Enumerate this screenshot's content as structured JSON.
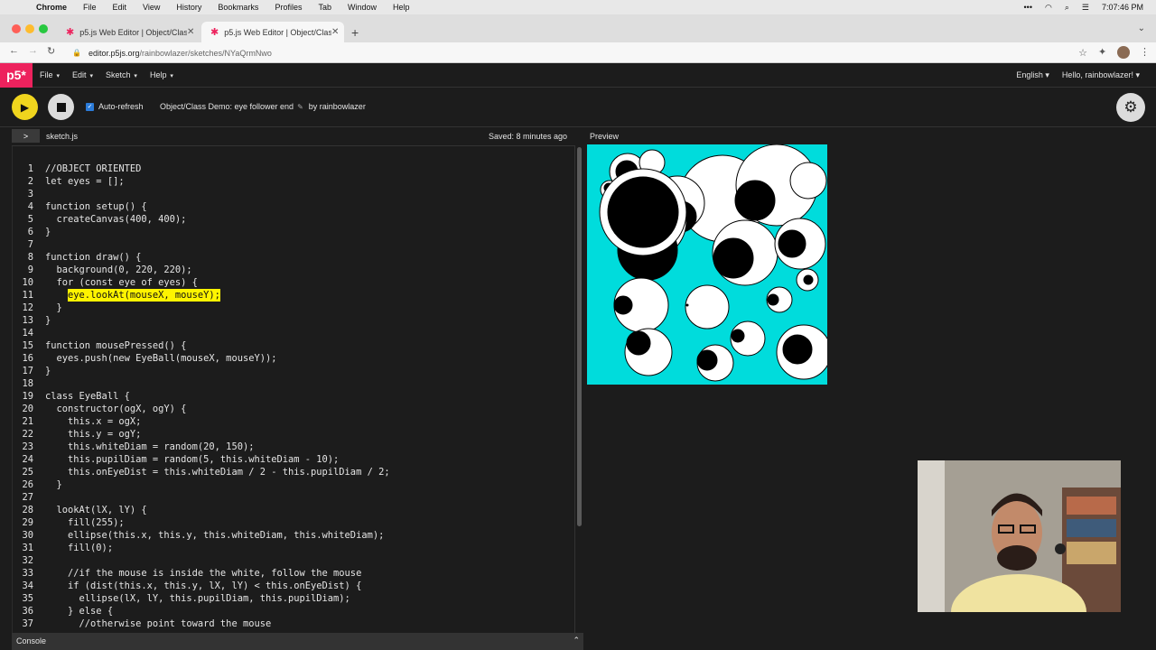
{
  "menubar": {
    "app": "Chrome",
    "items": [
      "File",
      "Edit",
      "View",
      "History",
      "Bookmarks",
      "Profiles",
      "Tab",
      "Window",
      "Help"
    ],
    "clock": "7:07:46 PM"
  },
  "browser": {
    "tabs": [
      {
        "title": "p5.js Web Editor | Object/Class"
      },
      {
        "title": "p5.js Web Editor | Object/Class"
      }
    ],
    "url_domain": "editor.p5js.org",
    "url_path": "/rainbowlazer/sketches/NYaQrmNwo"
  },
  "editor_nav": {
    "logo": "p5*",
    "menus": [
      "File",
      "Edit",
      "Sketch",
      "Help"
    ],
    "language": "English",
    "user_greeting": "Hello, rainbowlazer!"
  },
  "toolbar": {
    "auto_refresh_label": "Auto-refresh",
    "sketch_title": "Object/Class Demo: eye follower end",
    "author": "by rainbowlazer"
  },
  "file_header": {
    "filename": "sketch.js",
    "saved_status": "Saved: 8 minutes ago",
    "preview_label": "Preview"
  },
  "code": {
    "lines": [
      "//OBJECT ORIENTED",
      "let eyes = [];",
      "",
      "function setup() {",
      "  createCanvas(400, 400);",
      "}",
      "",
      "function draw() {",
      "  background(0, 220, 220);",
      "  for (const eye of eyes) {",
      "    eye.lookAt(mouseX, mouseY);",
      "  }",
      "}",
      "",
      "function mousePressed() {",
      "  eyes.push(new EyeBall(mouseX, mouseY));",
      "}",
      "",
      "class EyeBall {",
      "  constructor(ogX, ogY) {",
      "    this.x = ogX;",
      "    this.y = ogY;",
      "    this.whiteDiam = random(20, 150);",
      "    this.pupilDiam = random(5, this.whiteDiam - 10);",
      "    this.onEyeDist = this.whiteDiam / 2 - this.pupilDiam / 2;",
      "  }",
      "",
      "  lookAt(lX, lY) {",
      "    fill(255);",
      "    ellipse(this.x, this.y, this.whiteDiam, this.whiteDiam);",
      "    fill(0);",
      "",
      "    //if the mouse is inside the white, follow the mouse",
      "    if (dist(this.x, this.y, lX, lY) < this.onEyeDist) {",
      "      ellipse(lX, lY, this.pupilDiam, this.pupilDiam);",
      "    } else {",
      "      //otherwise point toward the mouse"
    ],
    "highlighted_line": 11
  },
  "console_label": "Console",
  "colors": {
    "accent": "#ed225d",
    "play": "#f0d51e",
    "canvas_bg": "#00dcdc",
    "highlight": "#fff400"
  }
}
